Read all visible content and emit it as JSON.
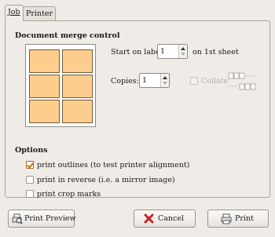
{
  "tabs": [
    {
      "label": "Job"
    },
    {
      "label": "Printer"
    }
  ],
  "merge": {
    "title": "Document merge control",
    "start_label": "Start on label",
    "start_value": "1",
    "start_suffix": "on 1st sheet",
    "copies_label": "Copies:",
    "copies_value": "1",
    "collate_label": "Collate"
  },
  "options": {
    "title": "Options",
    "items": [
      {
        "label": "print outlines (to test printer alignment)",
        "checked": true
      },
      {
        "label": "print in reverse (i.e. a mirror image)",
        "checked": false
      },
      {
        "label": "print crop marks",
        "checked": false
      }
    ]
  },
  "buttons": {
    "preview": "Print Preview",
    "cancel": "Cancel",
    "print": "Print"
  },
  "colors": {
    "label_fill": "#fdcd8e",
    "cancel_x": "#cc1f1f",
    "check": "#c3741b"
  }
}
